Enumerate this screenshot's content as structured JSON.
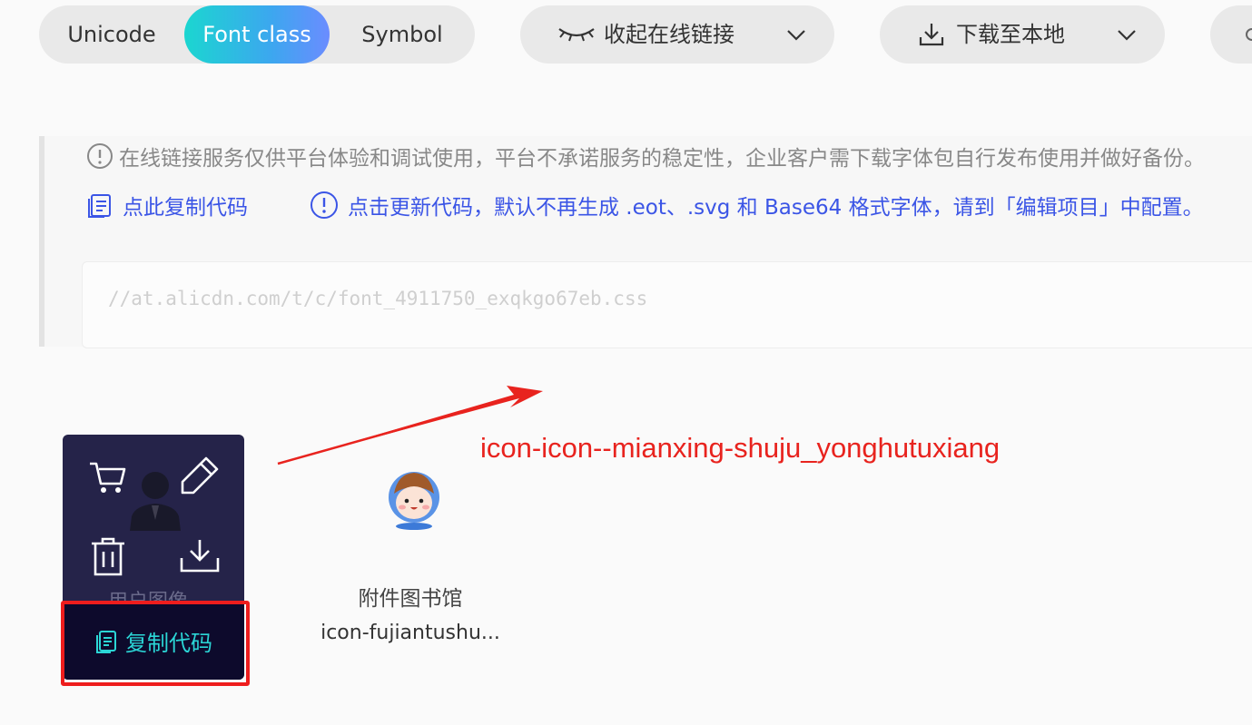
{
  "tabs": [
    "Unicode",
    "Font class",
    "Symbol"
  ],
  "active_tab": "Font class",
  "toolbar": {
    "collapse_label": "收起在线链接",
    "download_label": "下载至本地"
  },
  "notice": {
    "warning": "在线链接服务仅供平台体验和调试使用，平台不承诺服务的稳定性，企业客户需下载字体包自行发布使用并做好备份。",
    "copy_link": "点此复制代码",
    "update_link": "点击更新代码，默认不再生成 .eot、.svg 和 Base64 格式字体，请到「编辑项目」中配置。",
    "code_url": "//at.alicdn.com/t/c/font_4911750_exqkgo67eb.css"
  },
  "annotation": "icon-icon--mianxing-shuju_yonghutuxiang",
  "icons": [
    {
      "name": "用户图像",
      "copy_label": "复制代码",
      "icon": "user-avatar-icon"
    },
    {
      "name": "附件图书馆",
      "code": "icon-fujiantushu...",
      "icon": "cartoon-avatar-icon"
    }
  ],
  "colors": {
    "accent_gradient": [
      "#1bd6d0",
      "#6b8cff"
    ],
    "link_blue": "#3b55e6",
    "annotation_red": "#e8231e",
    "card_bg": "#252349",
    "copy_text": "#2bd6d6"
  }
}
